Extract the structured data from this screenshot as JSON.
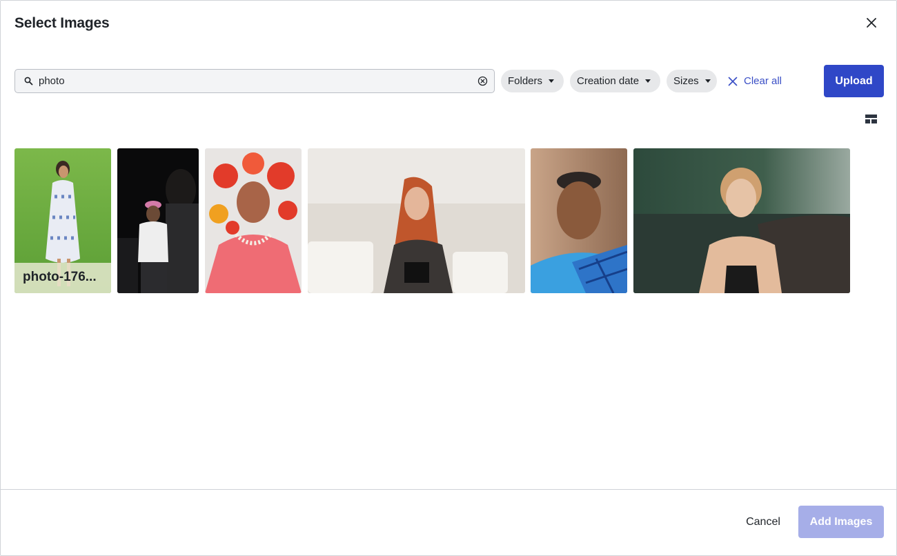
{
  "dialog": {
    "title": "Select Images",
    "close_icon": "close-icon"
  },
  "search": {
    "value": "photo",
    "placeholder": "",
    "icon": "search-icon",
    "clear_icon": "clear-circle-icon"
  },
  "filters": [
    {
      "label": "Folders",
      "icon": "caret-down-icon"
    },
    {
      "label": "Creation date",
      "icon": "caret-down-icon"
    },
    {
      "label": "Sizes",
      "icon": "caret-down-icon"
    }
  ],
  "clear_all": {
    "label": "Clear all",
    "icon": "x-icon"
  },
  "upload": {
    "label": "Upload"
  },
  "layout_toggle": {
    "icon": "layout-grid-icon"
  },
  "images": [
    {
      "caption": "photo-176...",
      "description": "woman in floral dress on grass"
    },
    {
      "caption": "",
      "description": "man in pink beanie at night"
    },
    {
      "caption": "",
      "description": "woman with red flower headdress"
    },
    {
      "caption": "",
      "description": "red-haired woman on sofa"
    },
    {
      "caption": "",
      "description": "elderly woman in blue sari"
    },
    {
      "caption": "",
      "description": "woman in field at sunset"
    }
  ],
  "footer": {
    "cancel_label": "Cancel",
    "add_label": "Add Images"
  },
  "colors": {
    "accent": "#2f47c7",
    "accent_disabled": "#a6aee8",
    "link": "#3a4fc6",
    "pill_bg": "#e7e8ea"
  }
}
